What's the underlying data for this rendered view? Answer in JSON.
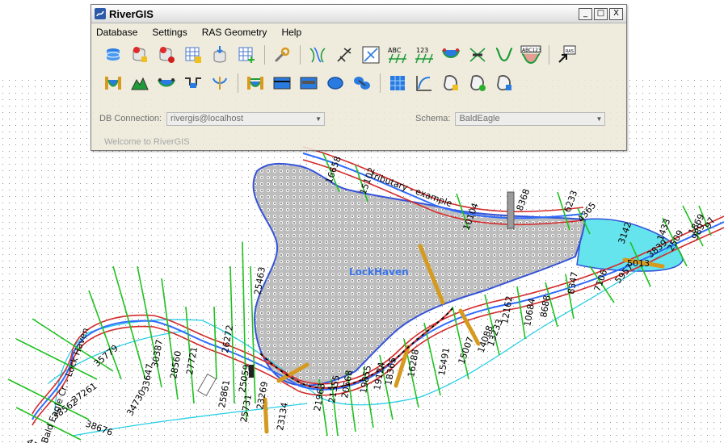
{
  "window": {
    "title": "RiverGIS",
    "minimize": "_",
    "maximize": "□",
    "close": "X"
  },
  "menu": [
    "Database",
    "Settings",
    "RAS Geometry",
    "Help"
  ],
  "toolbar_row1": [
    "db-layers-icon",
    "db-add-icon",
    "db-remove-icon",
    "table-create-icon",
    "db-import-icon",
    "table-add-icon",
    "settings-wrench-icon",
    "stream-centerline-icon",
    "flowpaths-icon",
    "cross-sections-icon",
    "abc-labels-icon",
    "123-stations-icon",
    "banks-icon",
    "bridges-icon",
    "channel-icon",
    "abc123-attributes-icon",
    "export-ras-icon"
  ],
  "toolbar_row2": [
    "profile-icon",
    "mannings-icon",
    "levees-icon",
    "ineffective-icon",
    "blocked-icon",
    "storage-area-icon",
    "lateral-structure-icon",
    "sa-connection-icon",
    "breaklines-icon",
    "breakpoints-icon",
    "raster-icon",
    "velocity-icon",
    "mesh-a-icon",
    "mesh-b-icon",
    "mesh-c-icon"
  ],
  "db": {
    "connection_label": "DB Connection:",
    "connection_value": "rivergis@localhost",
    "schema_label": "Schema:",
    "schema_value": "BaldEagle"
  },
  "welcome": "Welcome to RiverGIS",
  "map": {
    "area_name": "LockHaven",
    "tributary_label": "tributary - example",
    "river_label": "Bald Eagle Cr. - Lock Haven",
    "stations": [
      "16658",
      "15102",
      "10104",
      "8368",
      "6233",
      "4365",
      "3142",
      "1433",
      "989",
      "97",
      "1869",
      "2509",
      "3839",
      "5013",
      "5957",
      "7106",
      "8347",
      "8688",
      "10684",
      "12162",
      "13233",
      "14088",
      "15007",
      "15491",
      "16288",
      "18365",
      "19124",
      "19855",
      "20568",
      "21355",
      "21963",
      "23134",
      "23269",
      "25731",
      "25059",
      "25861",
      "26272",
      "25463",
      "27721",
      "28560",
      "30387",
      "33647",
      "34730",
      "35779",
      "37261",
      "38562",
      "38676",
      "4120"
    ]
  },
  "colors": {
    "river": "#2f6bff",
    "bank": "#d42a2a",
    "cross_section": "#1fc11f",
    "flowpath": "#27cfe6",
    "storage_area_border": "#3553d8",
    "storage_area_fill": "#b7b7b7",
    "lake": "#65e4ee",
    "structure": "#d59a1e"
  }
}
